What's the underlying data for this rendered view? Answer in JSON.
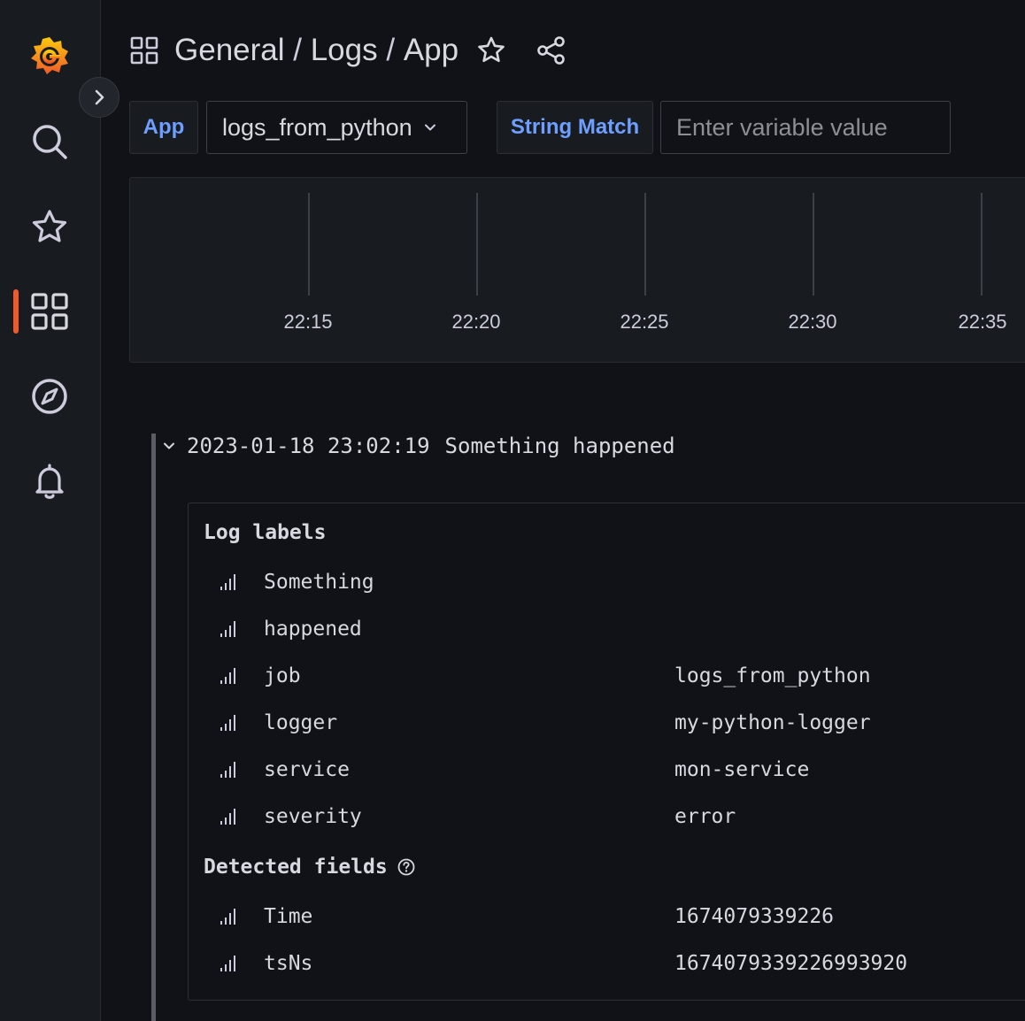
{
  "breadcrumb": {
    "folder": "General",
    "sep1": " / ",
    "group": "Logs",
    "sep2": " / ",
    "dashboard": "App"
  },
  "variables": {
    "app_label": "App",
    "app_value": "logs_from_python",
    "string_match_label": "String Match",
    "string_match_placeholder": "Enter variable value",
    "string_match_value": ""
  },
  "graph": {
    "x_ticks": [
      "22:15",
      "22:20",
      "22:25",
      "22:30",
      "22:35"
    ]
  },
  "log": {
    "timestamp": "2023-01-18 23:02:19",
    "message": "Something happened",
    "details": {
      "labels_title": "Log labels",
      "labels": [
        {
          "key": "Something",
          "value": ""
        },
        {
          "key": "happened",
          "value": ""
        },
        {
          "key": "job",
          "value": "logs_from_python"
        },
        {
          "key": "logger",
          "value": "my-python-logger"
        },
        {
          "key": "service",
          "value": "mon-service"
        },
        {
          "key": "severity",
          "value": "error"
        }
      ],
      "fields_title": "Detected fields",
      "fields": [
        {
          "key": "Time",
          "value": "1674079339226"
        },
        {
          "key": "tsNs",
          "value": "1674079339226993920"
        }
      ]
    }
  },
  "colors": {
    "accent": "#f05a28",
    "label_blue": "#6e9fff",
    "background": "#111217",
    "panel": "#181b1f"
  },
  "icons": {
    "nav": [
      "grafana-logo-icon",
      "search-icon",
      "star-icon",
      "dashboards-icon",
      "explore-compass-icon",
      "alerting-bell-icon"
    ],
    "header": [
      "dashboards-grid-icon",
      "star-outline-icon",
      "share-icon"
    ]
  }
}
